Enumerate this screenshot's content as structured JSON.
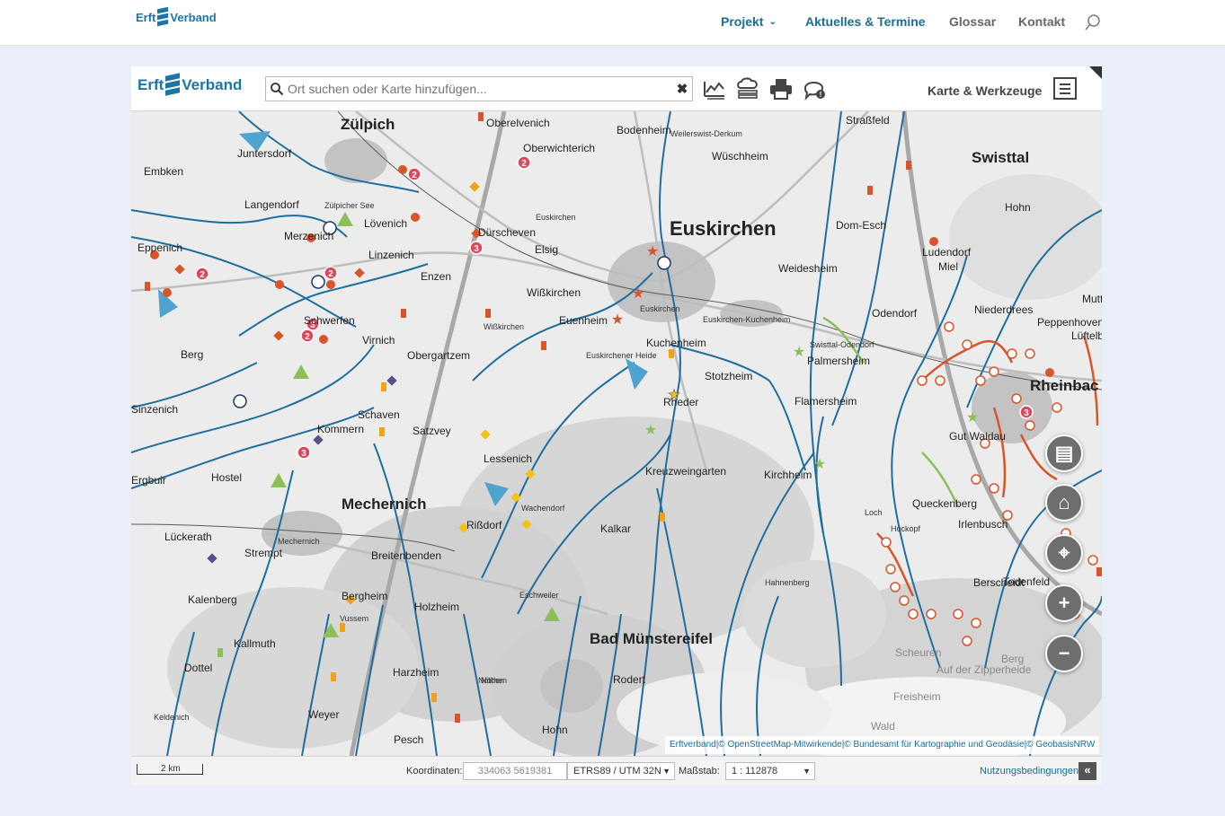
{
  "site": {
    "logo_left": "Erft",
    "logo_right": "Verband",
    "nav": [
      {
        "label": "Projekt",
        "has_dropdown": true
      },
      {
        "label": "Aktuelles & Termine"
      },
      {
        "label": "Glossar"
      },
      {
        "label": "Kontakt"
      }
    ]
  },
  "app": {
    "logo_left": "Erft",
    "logo_right": "Verband",
    "search_placeholder": "Ort suchen oder Karte hinzufügen...",
    "clear_label": "✖",
    "tools_label": "Karte & Werkzeuge",
    "tools": [
      "profile-tool-icon",
      "layers-cloud-icon",
      "print-icon",
      "feedback-icon"
    ]
  },
  "map": {
    "places": [
      {
        "name": "Euskirchen",
        "cls": "p-xl"
      },
      {
        "name": "Zülpich",
        "cls": "p-l"
      },
      {
        "name": "Mechernich",
        "cls": "p-l"
      },
      {
        "name": "Bad Münstereifel",
        "cls": "p-l"
      },
      {
        "name": "Swisttal",
        "cls": "p-l"
      },
      {
        "name": "Rheinbac",
        "cls": "p-l"
      },
      {
        "name": "Oberelvenich",
        "cls": "p-m"
      },
      {
        "name": "Bodenheim",
        "cls": "p-m"
      },
      {
        "name": "Oberwichterich",
        "cls": "p-m"
      },
      {
        "name": "Weilerswist-Derkum",
        "cls": "p-s"
      },
      {
        "name": "Wüschheim",
        "cls": "p-m"
      },
      {
        "name": "Straßfeld",
        "cls": "p-m"
      },
      {
        "name": "Juntersdorf",
        "cls": "p-m"
      },
      {
        "name": "Embken",
        "cls": "p-m"
      },
      {
        "name": "Langendorf",
        "cls": "p-m"
      },
      {
        "name": "Lövenich",
        "cls": "p-m"
      },
      {
        "name": "Merzenich",
        "cls": "p-m"
      },
      {
        "name": "Dürscheven",
        "cls": "p-m"
      },
      {
        "name": "Elsig",
        "cls": "p-m"
      },
      {
        "name": "Euskirchen",
        "cls": "p-s"
      },
      {
        "name": "Dom-Esch",
        "cls": "p-m"
      },
      {
        "name": "Hohn",
        "cls": "p-m"
      },
      {
        "name": "Eppenich",
        "cls": "p-m"
      },
      {
        "name": "Linzenich",
        "cls": "p-m"
      },
      {
        "name": "Enzen",
        "cls": "p-m"
      },
      {
        "name": "Weidesheim",
        "cls": "p-m"
      },
      {
        "name": "Ludendorf",
        "cls": "p-m"
      },
      {
        "name": "Miel",
        "cls": "p-m"
      },
      {
        "name": "Wißkirchen",
        "cls": "p-m"
      },
      {
        "name": "Euskirchen",
        "cls": "p-s"
      },
      {
        "name": "Euskirchen-Kuchenheim",
        "cls": "p-s"
      },
      {
        "name": "Niederdrees",
        "cls": "p-m"
      },
      {
        "name": "Peppenhoven",
        "cls": "p-m"
      },
      {
        "name": "Schwerfen",
        "cls": "p-m"
      },
      {
        "name": "Euenheim",
        "cls": "p-m"
      },
      {
        "name": "Odendorf",
        "cls": "p-m"
      },
      {
        "name": "Lüftelb",
        "cls": "p-m"
      },
      {
        "name": "Virnich",
        "cls": "p-m"
      },
      {
        "name": "Kuchenheim",
        "cls": "p-m"
      },
      {
        "name": "Palmersheim",
        "cls": "p-m"
      },
      {
        "name": "Berg",
        "cls": "p-m"
      },
      {
        "name": "Obergartzem",
        "cls": "p-m"
      },
      {
        "name": "Euskirchener Heide",
        "cls": "p-s"
      },
      {
        "name": "Stotzheim",
        "cls": "p-m"
      },
      {
        "name": "Flamersheim",
        "cls": "p-m"
      },
      {
        "name": "Sinzenich",
        "cls": "p-m"
      },
      {
        "name": "Rheder",
        "cls": "p-m"
      },
      {
        "name": "Schaven",
        "cls": "p-m"
      },
      {
        "name": "Kommern",
        "cls": "p-m"
      },
      {
        "name": "Satzvey",
        "cls": "p-m"
      },
      {
        "name": "Gut Waldau",
        "cls": "p-m"
      },
      {
        "name": "Lessenich",
        "cls": "p-m"
      },
      {
        "name": "Hostel",
        "cls": "p-m"
      },
      {
        "name": "Kreuzweingarten",
        "cls": "p-m"
      },
      {
        "name": "Kirchheim",
        "cls": "p-m"
      },
      {
        "name": "Wachendorf",
        "cls": "p-s"
      },
      {
        "name": "Queckenberg",
        "cls": "p-m"
      },
      {
        "name": "Loch",
        "cls": "p-s"
      },
      {
        "name": "Irlenbusch",
        "cls": "p-m"
      },
      {
        "name": "Lückerath",
        "cls": "p-m"
      },
      {
        "name": "Rißdorf",
        "cls": "p-m"
      },
      {
        "name": "Kalkar",
        "cls": "p-m"
      },
      {
        "name": "Strempt",
        "cls": "p-m"
      },
      {
        "name": "Mechernich",
        "cls": "p-s"
      },
      {
        "name": "Breitenbenden",
        "cls": "p-m"
      },
      {
        "name": "Berscheidt",
        "cls": "p-m"
      },
      {
        "name": "Todenfeld",
        "cls": "p-m"
      },
      {
        "name": "Kalenberg",
        "cls": "p-m"
      },
      {
        "name": "Bergheim",
        "cls": "p-m"
      },
      {
        "name": "Eschweiler",
        "cls": "p-s"
      },
      {
        "name": "Holzheim",
        "cls": "p-m"
      },
      {
        "name": "Kallmuth",
        "cls": "p-m"
      },
      {
        "name": "Vussem",
        "cls": "p-s"
      },
      {
        "name": "Dottel",
        "cls": "p-m"
      },
      {
        "name": "Harzheim",
        "cls": "p-m"
      },
      {
        "name": "Rodert",
        "cls": "p-m"
      },
      {
        "name": "Scheuren",
        "cls": "p-faded"
      },
      {
        "name": "Freisheim",
        "cls": "p-faded"
      },
      {
        "name": "Berg",
        "cls": "p-faded"
      },
      {
        "name": "Nöthen",
        "cls": "p-s"
      },
      {
        "name": "Weyer",
        "cls": "p-m"
      },
      {
        "name": "Hohn",
        "cls": "p-m"
      },
      {
        "name": "Wald",
        "cls": "p-faded"
      },
      {
        "name": "Keldenich",
        "cls": "p-s"
      },
      {
        "name": "Pesch",
        "cls": "p-m"
      },
      {
        "name": "Ergbuir",
        "cls": "p-m"
      },
      {
        "name": "Nöthen",
        "cls": "p-s"
      },
      {
        "name": "Muttl",
        "cls": "p-m"
      },
      {
        "name": "Swisttal-Odendorf",
        "cls": "p-s"
      },
      {
        "name": "Hockopf",
        "cls": "p-s"
      },
      {
        "name": "Hahnenberg",
        "cls": "p-s"
      },
      {
        "name": "Zülpicher See",
        "cls": "p-s"
      },
      {
        "name": "Wißkirchen",
        "cls": "p-s"
      },
      {
        "name": "Auf der Zipperheide",
        "cls": "p-faded"
      }
    ],
    "attribution": "Erftverband|© OpenStreetMap-Mitwirkende|© Bundesamt für Kartographie und Geodäsie|© GeobasisNRW",
    "controls": [
      "legend-icon",
      "home-icon",
      "locate-icon",
      "zoom-in-icon",
      "zoom-out-icon"
    ],
    "controls_glyphs": [
      "▤",
      "⌂",
      "⌖",
      "+",
      "−"
    ]
  },
  "status": {
    "scale_text": "2 km",
    "coord_label": "Koordinaten:",
    "coord_value": "334063 5619381",
    "crs": "ETRS89 / UTM 32N",
    "scale_label": "Maßstab:",
    "scale_value": "1 :  112878",
    "terms": "Nutzungsbedingungen",
    "collapse": "«"
  },
  "colors": {
    "brand": "#1a76a8",
    "river": "#1e6e9f",
    "marker_red": "#e0465a",
    "marker_orange": "#d9542b",
    "marker_yellow": "#f2c215",
    "marker_green": "#8cbf5a",
    "marker_purple": "#5b4f8a"
  }
}
